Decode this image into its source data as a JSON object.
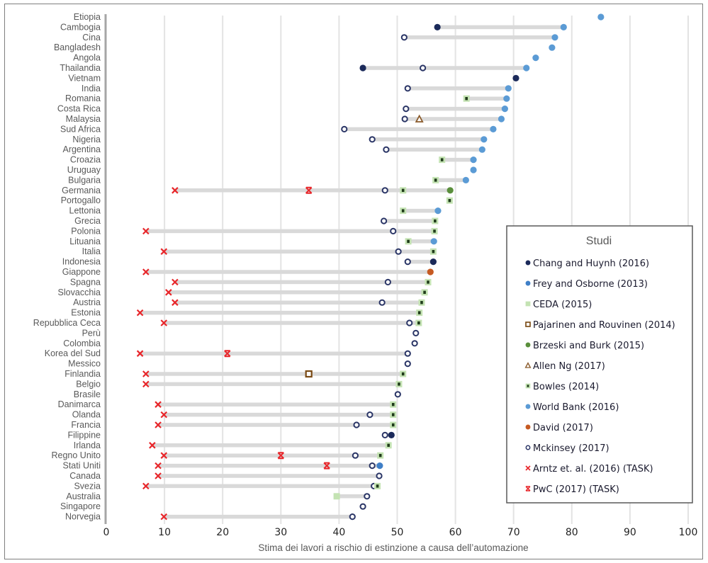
{
  "chart_data": {
    "type": "scatter",
    "subtype": "dot-range",
    "title": "",
    "xlabel": "Stima dei lavori  a rischio di estinzione  a causa dell’automazione",
    "ylabel": "",
    "xlim": [
      0,
      100
    ],
    "xticks": [
      0,
      10,
      20,
      30,
      40,
      50,
      60,
      70,
      80,
      90,
      100
    ],
    "grid": "vertical",
    "legend": {
      "title": "Studi",
      "placement": "right",
      "entries": [
        {
          "key": "chang",
          "label": "Chang and Huynh (2016)",
          "marker": "filled-circle",
          "color": "#1b2a5a"
        },
        {
          "key": "frey",
          "label": "Frey and Osborne (2013)",
          "marker": "filled-circle",
          "color": "#3f7fc7"
        },
        {
          "key": "ceda",
          "label": "CEDA (2015)",
          "marker": "filled-square",
          "color": "#c4e3b3"
        },
        {
          "key": "pajarinen",
          "label": "Pajarinen and Rouvinen (2014)",
          "marker": "hollow-square",
          "color": "#7a4a14"
        },
        {
          "key": "brzeski",
          "label": "Brzeski and Burk (2015)",
          "marker": "filled-circle",
          "color": "#5a8f3c"
        },
        {
          "key": "allen",
          "label": "Allen Ng (2017)",
          "marker": "hollow-triangle",
          "color": "#8a5a2a"
        },
        {
          "key": "bowles",
          "label": "Bowles (2014)",
          "marker": "square-dot",
          "color": "#c4e3b3",
          "inner_color": "#1f3b1a"
        },
        {
          "key": "worldbank",
          "label": "World Bank (2016)",
          "marker": "filled-circle",
          "color": "#5b9bd5"
        },
        {
          "key": "david",
          "label": "David (2017)",
          "marker": "filled-circle",
          "color": "#c65a22"
        },
        {
          "key": "mckinsey",
          "label": "Mckinsey (2017)",
          "marker": "hollow-circle",
          "color": "#2a3566"
        },
        {
          "key": "arntz",
          "label": "Arntz et. al. (2016) (TASK)",
          "marker": "x",
          "color": "#e8262a"
        },
        {
          "key": "pwc",
          "label": "PwC (2017) (TASK)",
          "marker": "x-bold",
          "color": "#e8262a"
        }
      ]
    },
    "categories": [
      "Etiopia",
      "Cambogia",
      "Cina",
      "Bangladesh",
      "Angola",
      "Thailandia",
      "Vietnam",
      "India",
      "Romania",
      "Costa Rica",
      "Malaysia",
      "Sud Africa",
      "Nigeria",
      "Argentina",
      "Croazia",
      "Uruguay",
      "Bulgaria",
      "Germania",
      "Portogallo",
      "Lettonia",
      "Grecia",
      "Polonia",
      "Lituania",
      "Italia",
      "Indonesia",
      "Giappone",
      "Spagna",
      "Slovacchia",
      "Austria",
      "Estonia",
      "Repubblica Ceca",
      "Perù",
      "Colombia",
      "Korea del Sud",
      "Messico",
      "Finlandia",
      "Belgio",
      "Brasile",
      "Danimarca",
      "Olanda",
      "Francia",
      "Filippine",
      "Irlanda",
      "Regno Unito",
      "Stati Uniti",
      "Canada",
      "Svezia",
      "Australia",
      "Singapore",
      "Norvegia"
    ],
    "rows": [
      {
        "country": "Etiopia",
        "points": {
          "worldbank": 85.0
        }
      },
      {
        "country": "Cambogia",
        "points": {
          "chang": 56.9,
          "worldbank": 78.6
        }
      },
      {
        "country": "Cina",
        "points": {
          "mckinsey": 51.2,
          "worldbank": 77.1
        }
      },
      {
        "country": "Bangladesh",
        "points": {
          "worldbank": 76.6
        }
      },
      {
        "country": "Angola",
        "points": {
          "worldbank": 73.8
        }
      },
      {
        "country": "Thailandia",
        "points": {
          "chang": 44.1,
          "mckinsey": 54.4,
          "worldbank": 72.2
        }
      },
      {
        "country": "Vietnam",
        "points": {
          "chang": 70.4
        }
      },
      {
        "country": "India",
        "points": {
          "mckinsey": 51.8,
          "worldbank": 69.1
        }
      },
      {
        "country": "Romania",
        "points": {
          "bowles": 61.9,
          "worldbank": 68.8
        }
      },
      {
        "country": "Costa Rica",
        "points": {
          "mckinsey": 51.5,
          "worldbank": 68.5
        }
      },
      {
        "country": "Malaysia",
        "points": {
          "mckinsey": 51.3,
          "allen": 53.8,
          "worldbank": 67.9
        }
      },
      {
        "country": "Sud Africa",
        "points": {
          "mckinsey": 40.9,
          "worldbank": 66.5
        }
      },
      {
        "country": "Nigeria",
        "points": {
          "mckinsey": 45.7,
          "worldbank": 64.9
        }
      },
      {
        "country": "Argentina",
        "points": {
          "mckinsey": 48.1,
          "worldbank": 64.6
        }
      },
      {
        "country": "Croazia",
        "points": {
          "bowles": 57.7,
          "worldbank": 63.1
        }
      },
      {
        "country": "Uruguay",
        "points": {
          "worldbank": 63.1
        }
      },
      {
        "country": "Bulgaria",
        "points": {
          "bowles": 56.6,
          "worldbank": 61.8
        }
      },
      {
        "country": "Germania",
        "points": {
          "arntz": 11.8,
          "pwc": 34.8,
          "mckinsey": 47.9,
          "bowles": 51.0,
          "brzeski": 59.1
        }
      },
      {
        "country": "Portogallo",
        "points": {
          "bowles": 59.0
        }
      },
      {
        "country": "Lettonia",
        "points": {
          "bowles": 51.0,
          "worldbank": 57.0
        }
      },
      {
        "country": "Grecia",
        "points": {
          "mckinsey": 47.7,
          "bowles": 56.5
        }
      },
      {
        "country": "Polonia",
        "points": {
          "arntz": 6.8,
          "mckinsey": 49.3,
          "bowles": 56.4
        }
      },
      {
        "country": "Lituania",
        "points": {
          "bowles": 51.9,
          "worldbank": 56.3
        }
      },
      {
        "country": "Italia",
        "points": {
          "arntz": 9.9,
          "mckinsey": 50.2,
          "bowles": 56.2
        }
      },
      {
        "country": "Indonesia",
        "points": {
          "mckinsey": 51.8,
          "chang": 56.2
        }
      },
      {
        "country": "Giappone",
        "points": {
          "arntz": 6.8,
          "david": 55.7
        }
      },
      {
        "country": "Spagna",
        "points": {
          "arntz": 11.8,
          "mckinsey": 48.4,
          "bowles": 55.3
        }
      },
      {
        "country": "Slovacchia",
        "points": {
          "arntz": 10.7,
          "bowles": 54.7
        }
      },
      {
        "country": "Austria",
        "points": {
          "arntz": 11.8,
          "mckinsey": 47.4,
          "bowles": 54.2
        }
      },
      {
        "country": "Estonia",
        "points": {
          "arntz": 5.8,
          "bowles": 53.8
        }
      },
      {
        "country": "Repubblica Ceca",
        "points": {
          "arntz": 9.9,
          "mckinsey": 52.1,
          "bowles": 53.7
        }
      },
      {
        "country": "Perù",
        "points": {
          "mckinsey": 53.2
        }
      },
      {
        "country": "Colombia",
        "points": {
          "mckinsey": 53.0
        }
      },
      {
        "country": "Korea del Sud",
        "points": {
          "arntz": 5.8,
          "pwc": 20.8,
          "mckinsey": 51.8
        }
      },
      {
        "country": "Messico",
        "points": {
          "mckinsey": 51.8
        }
      },
      {
        "country": "Finlandia",
        "points": {
          "arntz": 6.8,
          "pajarinen": 34.8,
          "bowles": 51.0
        }
      },
      {
        "country": "Belgio",
        "points": {
          "arntz": 6.8,
          "bowles": 50.3
        }
      },
      {
        "country": "Brasile",
        "points": {
          "mckinsey": 50.1
        }
      },
      {
        "country": "Danimarca",
        "points": {
          "arntz": 8.9,
          "bowles": 49.3
        }
      },
      {
        "country": "Olanda",
        "points": {
          "arntz": 9.9,
          "mckinsey": 45.3,
          "bowles": 49.3
        }
      },
      {
        "country": "Francia",
        "points": {
          "arntz": 8.9,
          "mckinsey": 43.0,
          "bowles": 49.3
        }
      },
      {
        "country": "Filippine",
        "points": {
          "mckinsey": 47.9,
          "chang": 49.0
        }
      },
      {
        "country": "Irlanda",
        "points": {
          "arntz": 7.9,
          "bowles": 48.5
        }
      },
      {
        "country": "Regno Unito",
        "points": {
          "arntz": 9.9,
          "pwc": 30.0,
          "mckinsey": 42.8,
          "bowles": 47.1
        }
      },
      {
        "country": "Stati Uniti",
        "points": {
          "arntz": 8.9,
          "pwc": 37.9,
          "mckinsey": 45.7,
          "frey": 47.0
        }
      },
      {
        "country": "Canada",
        "points": {
          "arntz": 8.9,
          "mckinsey": 46.9
        }
      },
      {
        "country": "Svezia",
        "points": {
          "arntz": 6.8,
          "mckinsey": 46.0,
          "bowles": 46.6
        }
      },
      {
        "country": "Australia",
        "points": {
          "ceda": 39.6,
          "mckinsey": 44.8
        }
      },
      {
        "country": "Singapore",
        "points": {
          "mckinsey": 44.1
        }
      },
      {
        "country": "Norvegia",
        "points": {
          "arntz": 9.9,
          "mckinsey": 42.3
        }
      }
    ]
  },
  "colors": {
    "range_bar": "#d9d9d9",
    "gridline": "#e3e3e3",
    "axis_line": "#a6a6a6",
    "frame": "#7f7f7f"
  }
}
